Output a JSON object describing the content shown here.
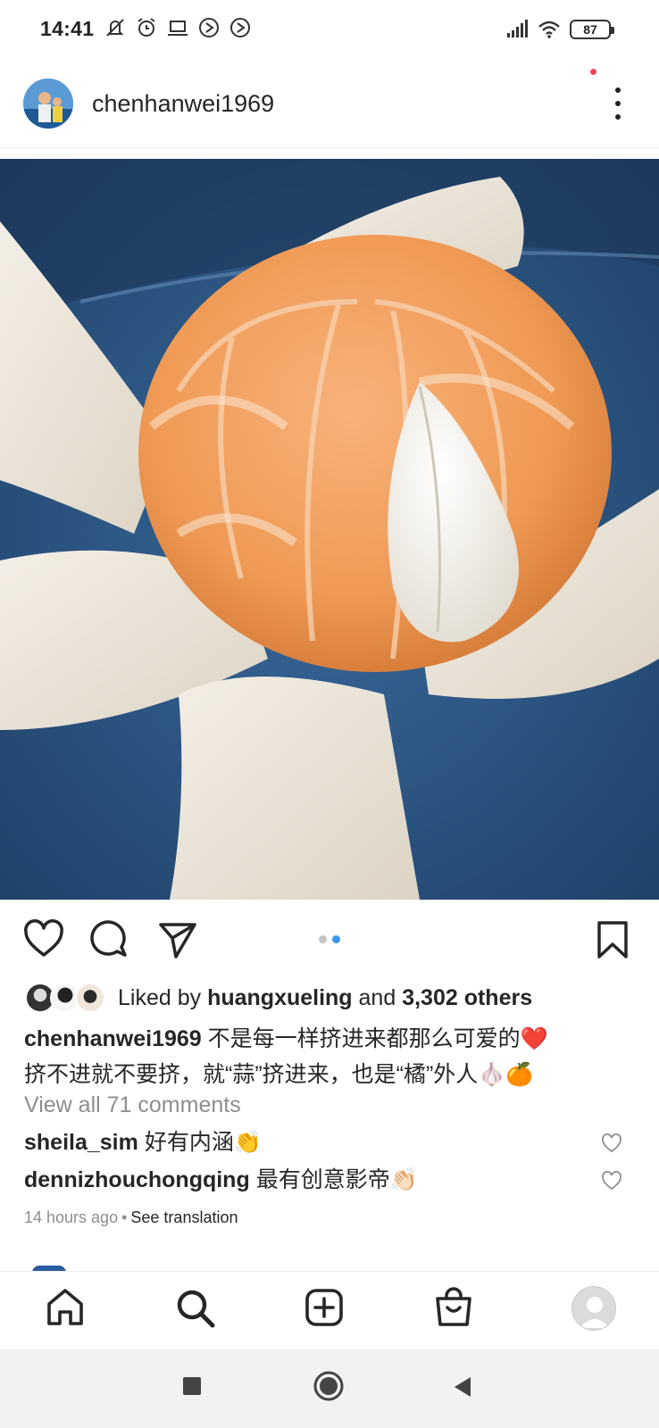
{
  "status_bar": {
    "time": "14:41",
    "battery": "87",
    "icons": [
      "mute-icon",
      "alarm-icon",
      "laptop-icon",
      "play-icon",
      "play-icon",
      "signal-icon",
      "wifi-icon",
      "battery-icon"
    ]
  },
  "post": {
    "username": "chenhanwei1969",
    "carousel": {
      "count": 2,
      "active": 2
    },
    "likes": {
      "prefix": "Liked by",
      "user": "huangxueling",
      "middle": "and",
      "others": "3,302 others"
    },
    "caption": {
      "user": "chenhanwei1969",
      "line1": "不是每一样挤进来都那么可爱的❤️",
      "line2": "挤不进就不要挤，就“蒜”挤进来，也是“橘”外人🧄🍊"
    },
    "view_comments": "View all 71 comments",
    "comments": [
      {
        "user": "sheila_sim",
        "text": "好有内涵👏"
      },
      {
        "user": "dennizhouchongqing",
        "text": "最有创意影帝👏🏻"
      }
    ],
    "time_ago": "14 hours ago",
    "separator": "•",
    "see_translation": "See translation"
  },
  "colors": {
    "accent_blue": "#3897f0",
    "notification_red": "#ed4956",
    "muted_text": "#8e8e8e"
  }
}
